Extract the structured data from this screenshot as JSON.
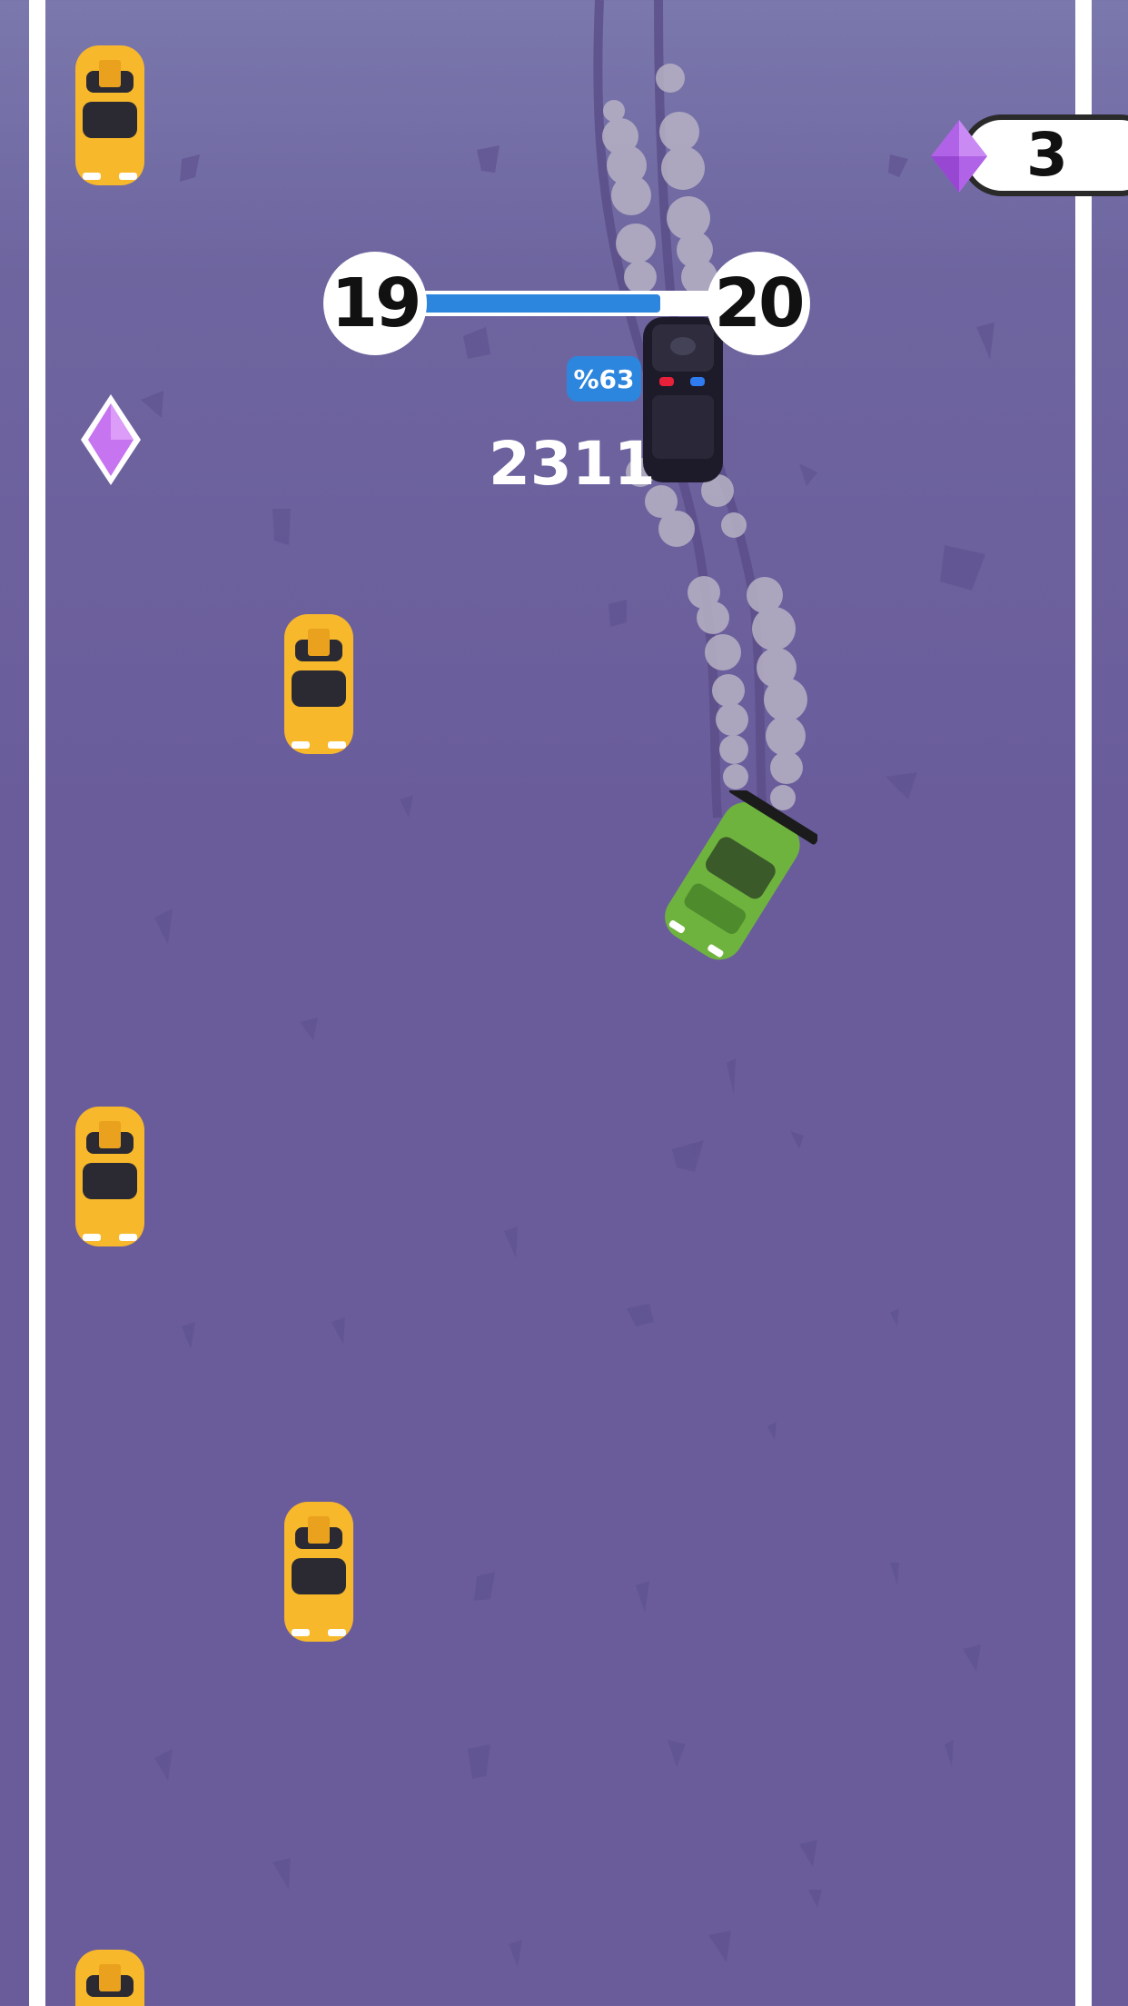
{
  "hud": {
    "gem_count": "3",
    "level_current": "19",
    "level_next": "20",
    "level_progress": 0.75,
    "boost_badge": "%63",
    "score": "2311"
  },
  "colors": {
    "road": "#6a5c9b",
    "lane_line": "#ffffff",
    "progress_fill": "#2d86de",
    "taxi": "#f7b82c",
    "player_car": "#6fb33f",
    "police_car": "#1d1b2a",
    "gem": "#c774f0"
  },
  "icons": [
    "gem-icon",
    "taxi-car",
    "police-car",
    "player-drift-car",
    "smoke-trail"
  ]
}
